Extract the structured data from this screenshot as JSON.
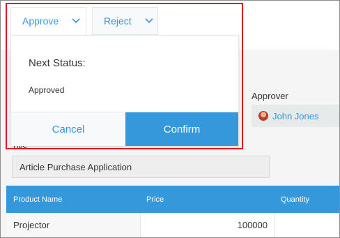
{
  "action_buttons": {
    "approve_label": "Approve",
    "reject_label": "Reject"
  },
  "status_popup": {
    "heading": "Next Status:",
    "status_value": "Approved",
    "cancel_label": "Cancel",
    "confirm_label": "Confirm"
  },
  "approver": {
    "label": "Approver",
    "name": "John Jones"
  },
  "title_field": {
    "label": "Title",
    "value": "Article Purchase Application"
  },
  "product_table": {
    "columns": [
      "Product Name",
      "Price",
      "Quantity"
    ],
    "rows": [
      {
        "product": "Projector",
        "price": "100000",
        "quantity": ""
      }
    ]
  },
  "colors": {
    "accent": "#3498db",
    "highlight": "#e0161e"
  },
  "icons": {
    "dropdown": "chevron-down-icon",
    "avatar": "user-avatar"
  }
}
